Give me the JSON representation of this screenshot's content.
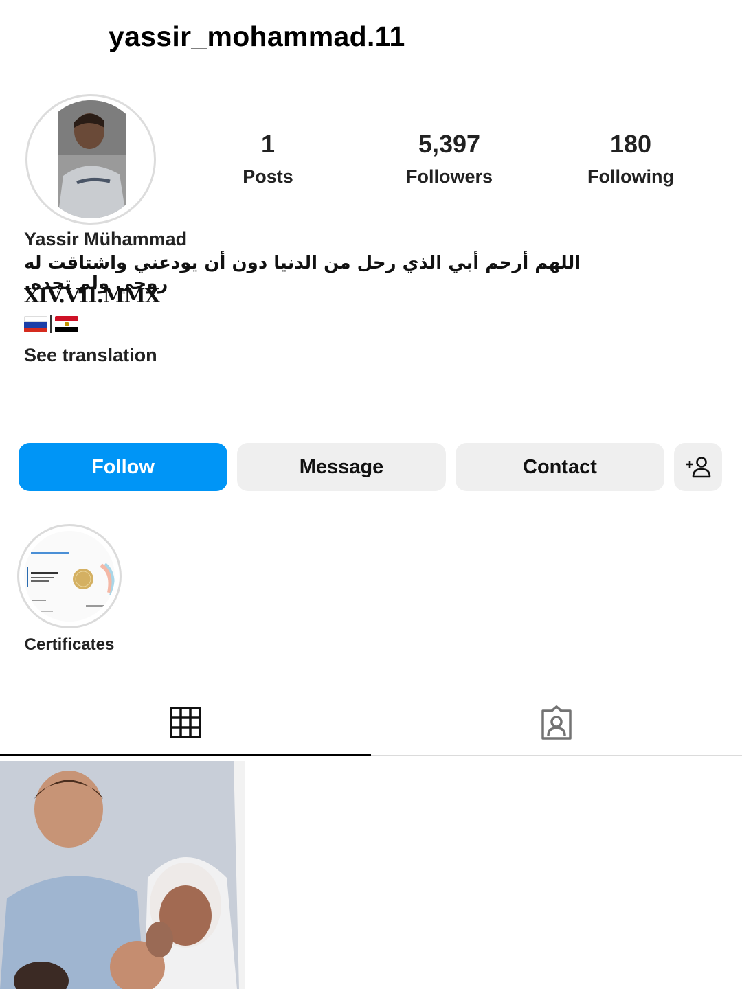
{
  "profile": {
    "username": "yassir_mohammad.11",
    "full_name": "Yassir Mühammad",
    "bio_line1": "اللهم أرحم أبي الذي رحل من الدنيا دون أن يودعني واشتاقت له روحي ولم تجده.",
    "bio_line2": "XIV.VII.MMX",
    "see_translation": "See translation"
  },
  "stats": {
    "posts_count": "1",
    "posts_label": "Posts",
    "followers_count": "5,397",
    "followers_label": "Followers",
    "following_count": "180",
    "following_label": "Following"
  },
  "actions": {
    "follow": "Follow",
    "message": "Message",
    "contact": "Contact",
    "add_icon": "person-add-icon"
  },
  "highlights": [
    {
      "label": "Certificates"
    }
  ],
  "tabs": [
    {
      "icon": "grid-icon",
      "selected": true
    },
    {
      "icon": "tagged-icon",
      "selected": false
    }
  ],
  "colors": {
    "accent": "#0095f6",
    "button_bg": "#efefef"
  }
}
